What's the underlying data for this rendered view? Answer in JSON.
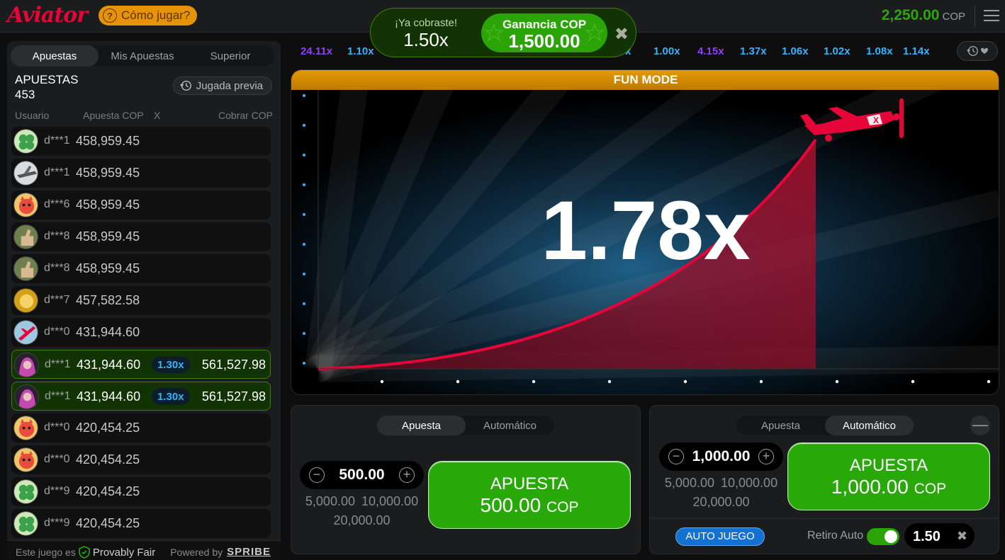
{
  "header": {
    "logo": "Aviator",
    "how_to_play": "Cómo jugar?",
    "balance": "2,250.00",
    "currency": "COP"
  },
  "toast": {
    "cashed_label": "¡Ya cobraste!",
    "cashed_mult": "1.50x",
    "gain_label": "Ganancia COP",
    "gain_value": "1,500.00",
    "close": "✖"
  },
  "left": {
    "tabs": [
      "Apuestas",
      "Mis Apuestas",
      "Superior"
    ],
    "bets_title": "APUESTAS",
    "bets_count": "453",
    "previous_round": "Jugada previa",
    "columns": {
      "user": "Usuario",
      "bet": "Apuesta COP",
      "mult": "X",
      "cashout": "Cobrar COP"
    },
    "rows": [
      {
        "user": "d***1",
        "amount": "458,959.45",
        "mult": "",
        "cashout": "",
        "avatar": "clover",
        "win": false
      },
      {
        "user": "d***1",
        "amount": "458,959.45",
        "mult": "",
        "cashout": "",
        "avatar": "jet",
        "win": false
      },
      {
        "user": "d***6",
        "amount": "458,959.45",
        "mult": "",
        "cashout": "",
        "avatar": "cat",
        "win": false
      },
      {
        "user": "d***8",
        "amount": "458,959.45",
        "mult": "",
        "cashout": "",
        "avatar": "thumb",
        "win": false
      },
      {
        "user": "d***8",
        "amount": "458,959.45",
        "mult": "",
        "cashout": "",
        "avatar": "thumb",
        "win": false
      },
      {
        "user": "d***7",
        "amount": "457,582.58",
        "mult": "",
        "cashout": "",
        "avatar": "gold",
        "win": false
      },
      {
        "user": "d***0",
        "amount": "431,944.60",
        "mult": "",
        "cashout": "",
        "avatar": "plane",
        "win": false
      },
      {
        "user": "d***1",
        "amount": "431,944.60",
        "mult": "1.30x",
        "cashout": "561,527.98",
        "avatar": "girl",
        "win": true
      },
      {
        "user": "d***1",
        "amount": "431,944.60",
        "mult": "1.30x",
        "cashout": "561,527.98",
        "avatar": "girl",
        "win": true
      },
      {
        "user": "d***0",
        "amount": "420,454.25",
        "mult": "",
        "cashout": "",
        "avatar": "cat",
        "win": false
      },
      {
        "user": "d***0",
        "amount": "420,454.25",
        "mult": "",
        "cashout": "",
        "avatar": "cat",
        "win": false
      },
      {
        "user": "d***9",
        "amount": "420,454.25",
        "mult": "",
        "cashout": "",
        "avatar": "clover",
        "win": false
      },
      {
        "user": "d***9",
        "amount": "420,454.25",
        "mult": "",
        "cashout": "",
        "avatar": "clover",
        "win": false
      }
    ],
    "footer": {
      "this_game_is": "Este juego es",
      "provably_fair": "Provably Fair",
      "powered_by": "Powered by",
      "brand": "SPRIBE"
    }
  },
  "history": [
    {
      "value": "24.11x",
      "color": "purple"
    },
    {
      "value": "1.10x",
      "color": "blue"
    },
    {
      "value": "x",
      "color": "blue"
    },
    {
      "value": "1.00x",
      "color": "blue"
    },
    {
      "value": "4.15x",
      "color": "purple"
    },
    {
      "value": "1.37x",
      "color": "blue"
    },
    {
      "value": "1.06x",
      "color": "blue"
    },
    {
      "value": "1.02x",
      "color": "blue"
    },
    {
      "value": "1.08x",
      "color": "blue"
    },
    {
      "value": "1.14x",
      "color": "blue"
    }
  ],
  "game": {
    "mode_banner": "FUN MODE",
    "multiplier": "1.78x"
  },
  "bet_panel_1": {
    "tabs": [
      "Apuesta",
      "Automático"
    ],
    "amount": "500.00",
    "quick": [
      "5,000.00",
      "10,000.00",
      "20,000.00"
    ],
    "button_label": "APUESTA",
    "button_amount": "500.00",
    "button_currency": "COP"
  },
  "bet_panel_2": {
    "tabs": [
      "Apuesta",
      "Automático"
    ],
    "amount": "1,000.00",
    "quick": [
      "5,000.00",
      "10,000.00",
      "20,000.00"
    ],
    "button_label": "APUESTA",
    "button_amount": "1,000.00",
    "button_currency": "COP",
    "collapse": "—",
    "auto_play": "AUTO JUEGO",
    "auto_cashout_label": "Retiro Auto",
    "auto_cashout_value": "1.50",
    "clear": "✖"
  },
  "colors": {
    "brand": "#e50539",
    "green": "#28a909",
    "blue": "#34b4ff",
    "purple": "#913ef8",
    "orange": "#e69308"
  }
}
